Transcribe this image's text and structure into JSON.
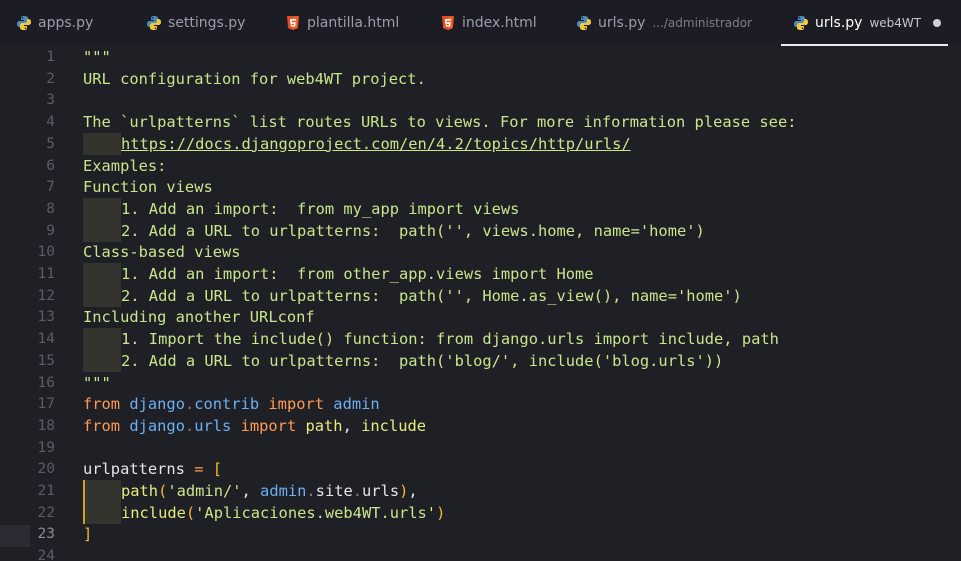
{
  "tabs": [
    {
      "label": "apps.py",
      "icon": "python-icon",
      "active": false
    },
    {
      "label": "settings.py",
      "icon": "python-icon",
      "active": false
    },
    {
      "label": "plantilla.html",
      "icon": "html5-icon",
      "active": false
    },
    {
      "label": "index.html",
      "icon": "html5-icon",
      "active": false
    },
    {
      "label": "urls.py",
      "desc": ".../administrador",
      "icon": "python-icon",
      "active": false
    },
    {
      "label": "urls.py",
      "desc": "web4WT",
      "icon": "python-icon",
      "active": true,
      "modified": true
    }
  ],
  "editor": {
    "current_line": 23,
    "lines": [
      {
        "n": "1",
        "tokens": [
          {
            "t": "\"\"\"",
            "k": "str"
          }
        ]
      },
      {
        "n": "2",
        "tokens": [
          {
            "t": "URL configuration for web4WT project.",
            "k": "str"
          }
        ]
      },
      {
        "n": "3",
        "tokens": []
      },
      {
        "n": "4",
        "tokens": [
          {
            "t": "The `urlpatterns` list routes URLs to views. For more information please see:",
            "k": "str"
          }
        ]
      },
      {
        "n": "5",
        "ws": 1,
        "tokens": [
          {
            "t": "https://docs.djangoproject.com/en/4.2/topics/http/urls/",
            "k": "link"
          }
        ]
      },
      {
        "n": "6",
        "tokens": [
          {
            "t": "Examples:",
            "k": "str"
          }
        ]
      },
      {
        "n": "7",
        "tokens": [
          {
            "t": "Function views",
            "k": "str"
          }
        ]
      },
      {
        "n": "8",
        "ws": 1,
        "tokens": [
          {
            "t": "1. Add an import:  from my_app import views",
            "k": "str"
          }
        ]
      },
      {
        "n": "9",
        "ws": 1,
        "tokens": [
          {
            "t": "2. Add a URL to urlpatterns:  path('', views.home, name='home')",
            "k": "str"
          }
        ]
      },
      {
        "n": "10",
        "tokens": [
          {
            "t": "Class-based views",
            "k": "str"
          }
        ]
      },
      {
        "n": "11",
        "ws": 1,
        "tokens": [
          {
            "t": "1. Add an import:  from other_app.views import Home",
            "k": "str"
          }
        ]
      },
      {
        "n": "12",
        "ws": 1,
        "tokens": [
          {
            "t": "2. Add a URL to urlpatterns:  path('', Home.as_view(), name='home')",
            "k": "str"
          }
        ]
      },
      {
        "n": "13",
        "tokens": [
          {
            "t": "Including another URLconf",
            "k": "str"
          }
        ]
      },
      {
        "n": "14",
        "ws": 1,
        "tokens": [
          {
            "t": "1. Import the include() function: from django.urls import include, path",
            "k": "str"
          }
        ]
      },
      {
        "n": "15",
        "ws": 1,
        "tokens": [
          {
            "t": "2. Add a URL to urlpatterns:  path('blog/', include('blog.urls'))",
            "k": "str"
          }
        ]
      },
      {
        "n": "16",
        "tokens": [
          {
            "t": "\"\"\"",
            "k": "str"
          }
        ]
      },
      {
        "n": "17",
        "tokens": [
          {
            "t": "from",
            "k": "kw"
          },
          {
            "t": " ",
            "k": "id"
          },
          {
            "t": "django",
            "k": "ns"
          },
          {
            "t": ".",
            "k": "dot"
          },
          {
            "t": "contrib",
            "k": "ns"
          },
          {
            "t": " ",
            "k": "id"
          },
          {
            "t": "import",
            "k": "kw"
          },
          {
            "t": " ",
            "k": "id"
          },
          {
            "t": "admin",
            "k": "ns"
          }
        ]
      },
      {
        "n": "18",
        "tokens": [
          {
            "t": "from",
            "k": "kw"
          },
          {
            "t": " ",
            "k": "id"
          },
          {
            "t": "django",
            "k": "ns"
          },
          {
            "t": ".",
            "k": "dot"
          },
          {
            "t": "urls",
            "k": "ns"
          },
          {
            "t": " ",
            "k": "id"
          },
          {
            "t": "import",
            "k": "kw"
          },
          {
            "t": " ",
            "k": "id"
          },
          {
            "t": "path",
            "k": "fn"
          },
          {
            "t": ", ",
            "k": "id"
          },
          {
            "t": "include",
            "k": "fn"
          }
        ]
      },
      {
        "n": "19",
        "tokens": []
      },
      {
        "n": "20",
        "tokens": [
          {
            "t": "urlpatterns",
            "k": "id"
          },
          {
            "t": " ",
            "k": "id"
          },
          {
            "t": "=",
            "k": "op"
          },
          {
            "t": " ",
            "k": "id"
          },
          {
            "t": "[",
            "k": "br"
          }
        ]
      },
      {
        "n": "21",
        "ws": 2,
        "tokens": [
          {
            "t": "path",
            "k": "fn"
          },
          {
            "t": "(",
            "k": "br"
          },
          {
            "t": "'admin/'",
            "k": "str"
          },
          {
            "t": ", ",
            "k": "id"
          },
          {
            "t": "admin",
            "k": "ns"
          },
          {
            "t": ".",
            "k": "dot"
          },
          {
            "t": "site",
            "k": "id"
          },
          {
            "t": ".",
            "k": "dot"
          },
          {
            "t": "urls",
            "k": "id"
          },
          {
            "t": ")",
            "k": "br"
          },
          {
            "t": ",",
            "k": "id"
          }
        ]
      },
      {
        "n": "22",
        "ws": 2,
        "tokens": [
          {
            "t": "include",
            "k": "fn"
          },
          {
            "t": "(",
            "k": "br"
          },
          {
            "t": "'Aplicaciones.web4WT.urls'",
            "k": "str"
          },
          {
            "t": ")",
            "k": "br"
          }
        ]
      },
      {
        "n": "23",
        "tokens": [
          {
            "t": "]",
            "k": "br"
          }
        ]
      },
      {
        "n": "24",
        "tokens": []
      }
    ]
  }
}
